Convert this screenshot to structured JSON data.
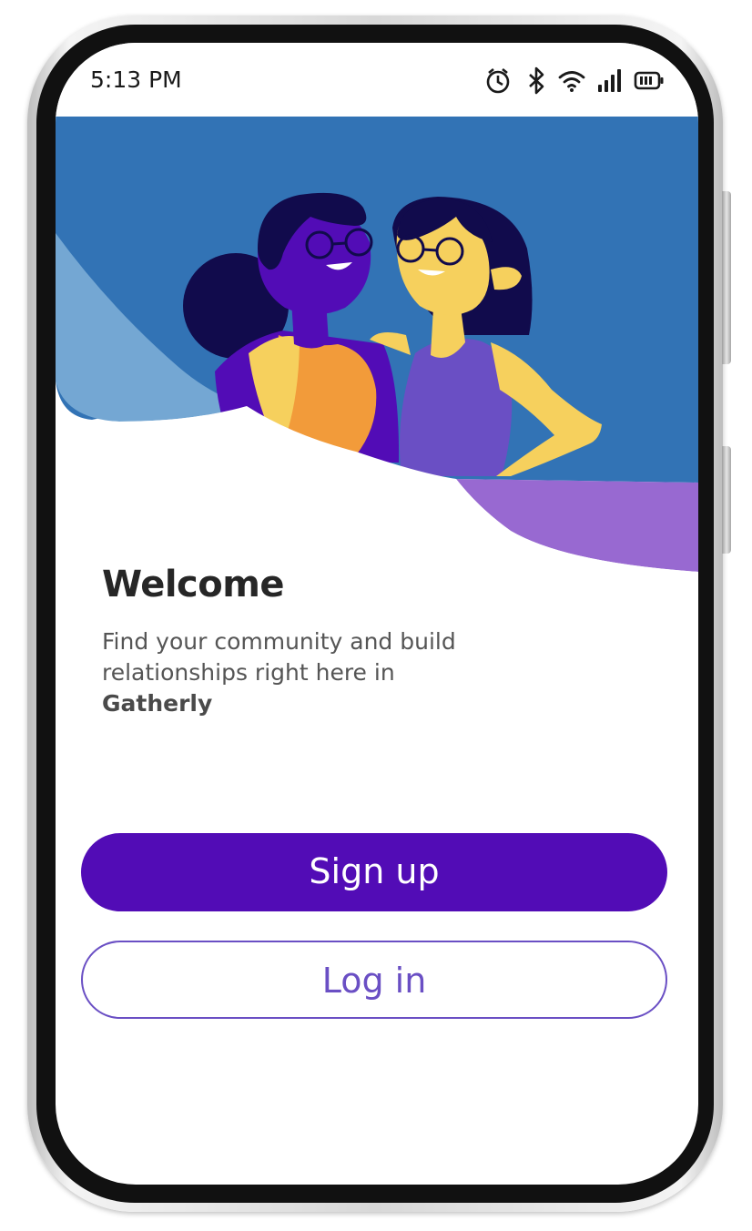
{
  "status_bar": {
    "time": "5:13 PM",
    "icons": [
      "alarm-icon",
      "bluetooth-icon",
      "wifi-icon",
      "signal-icon",
      "battery-icon"
    ]
  },
  "hero": {
    "illustration": "two-friends-illustration",
    "colors": {
      "background": "#3273b5",
      "light_wave": "#74a7d3",
      "purple_wave": "#9869d1"
    }
  },
  "welcome": {
    "title": "Welcome",
    "body": "Find your community and build relationships right here in",
    "brand": "Gatherly"
  },
  "actions": {
    "signup_label": "Sign up",
    "login_label": "Log in"
  },
  "colors": {
    "primary": "#520cb6",
    "outline": "#6a4fc4"
  }
}
